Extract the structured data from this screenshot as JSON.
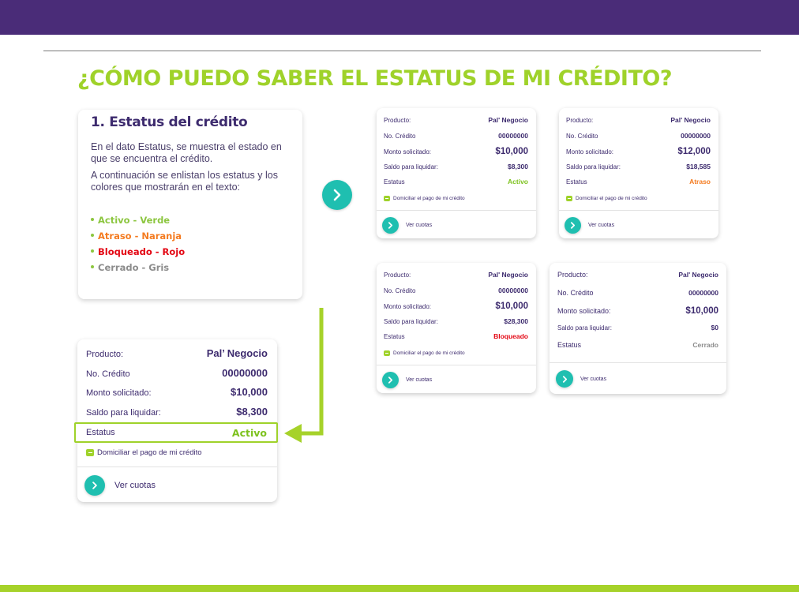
{
  "title": "¿CÓMO PUEDO SABER EL ESTATUS DE MI CRÉDITO?",
  "panel": {
    "heading": "1. Estatus del crédito",
    "paragraph1": "En el dato Estatus, se muestra el estado en que se encuentra el crédito.",
    "paragraph2": "A continuación se enlistan los estatus y los colores que mostrarán en el texto:",
    "legend": [
      {
        "label": "Activo - Verde",
        "color": "#8cc63f"
      },
      {
        "label": "Atraso - Naranja",
        "color": "#f47b20"
      },
      {
        "label": "Bloqueado - Rojo",
        "color": "#e30613"
      },
      {
        "label": "Cerrado - Gris",
        "color": "#8c8c8c"
      }
    ]
  },
  "labels": {
    "producto": "Producto:",
    "no_credito": "No. Crédito",
    "monto": "Monto solicitado:",
    "saldo": "Saldo para liquidar:",
    "estatus": "Estatus",
    "domiciliar": "Domiciliar el pago de mi crédito",
    "ver_cuotas": "Ver cuotas"
  },
  "cards": [
    {
      "producto": "Pal' Negocio",
      "no_credito": "00000000",
      "monto": "$10,000",
      "saldo": "$8,300",
      "estatus": "Activo",
      "estatus_color": "#7dc21e",
      "domiciliar": true
    },
    {
      "producto": "Pal' Negocio",
      "no_credito": "00000000",
      "monto": "$12,000",
      "saldo": "$18,585",
      "estatus": "Atraso",
      "estatus_color": "#f47b20",
      "domiciliar": true
    },
    {
      "producto": "Pal' Negocio",
      "no_credito": "00000000",
      "monto": "$10,000",
      "saldo": "$28,300",
      "estatus": "Bloqueado",
      "estatus_color": "#e30613",
      "domiciliar": true
    },
    {
      "producto": "Pal' Negocio",
      "no_credito": "00000000",
      "monto": "$10,000",
      "saldo": "$0",
      "estatus": "Cerrado",
      "estatus_color": "#8c8c8c",
      "domiciliar": false
    }
  ],
  "example_card": {
    "producto": "Pal’ Negocio",
    "no_credito": "00000000",
    "monto": "$10,000",
    "saldo": "$8,300",
    "estatus": "Activo"
  },
  "colors": {
    "header": "#4a2c78",
    "accent_green": "#9fd22a",
    "teal": "#1fbfb0",
    "text": "#3d2b6e"
  },
  "icons": {
    "next": "chevron-right-icon",
    "checkbox": "checkbox-icon",
    "arrow": "arrow-left-icon"
  }
}
